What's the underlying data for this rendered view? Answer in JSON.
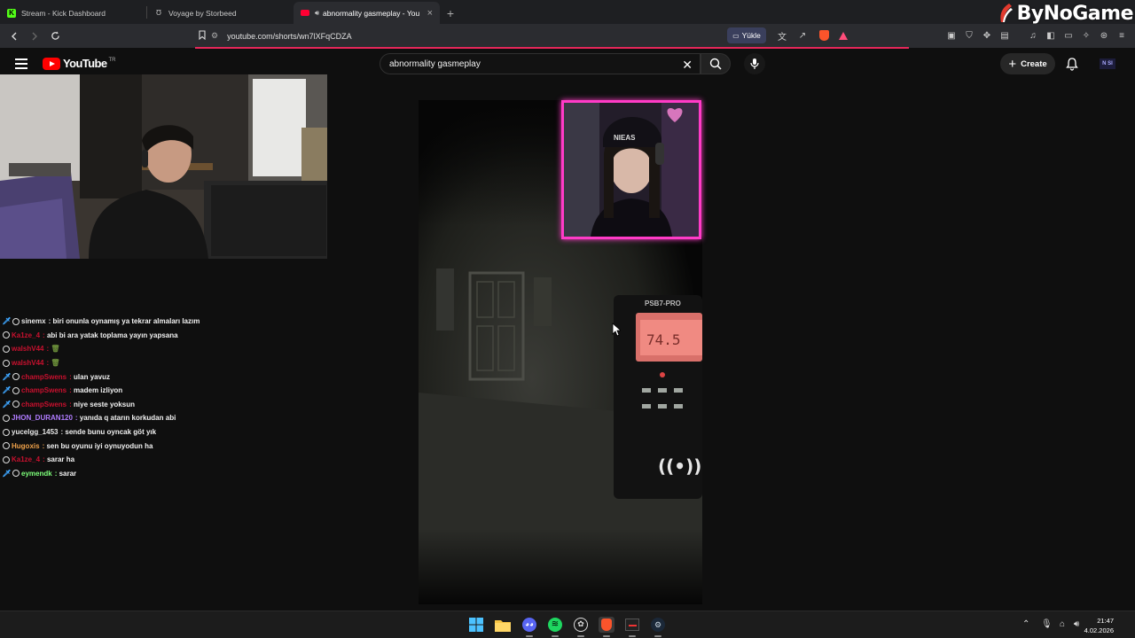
{
  "browser": {
    "tabs": [
      {
        "title": "Stream - Kick Dashboard",
        "favicon": "kick-icon",
        "color": "#53fc18",
        "active": false
      },
      {
        "title": "Voyage by Storbeed",
        "favicon": "storbeed-icon",
        "color": "#cccccc",
        "active": false
      },
      {
        "title": "abnormality gasmeplay - You",
        "favicon": "youtube-icon",
        "color": "#ff0033",
        "active": true
      }
    ],
    "new_tab": "+",
    "url": "youtube.com/shorts/wn7lXFqCDZA",
    "yukle_label": "Yükle",
    "overlay_logo": "ByNoGame"
  },
  "youtube": {
    "logo_text": "YouTube",
    "region": "TR",
    "search_value": "abnormality gasmeplay",
    "create_label": "Create",
    "avatar_text": "N SI"
  },
  "chat": [
    {
      "badges": [
        "sword",
        "ring"
      ],
      "name": "sinemx",
      "name_color": "#e8e8e8",
      "text": "biri onunla oynamış ya tekrar almaları lazım"
    },
    {
      "badges": [
        "ring"
      ],
      "name": "Ka1ze_4",
      "name_color": "#c8102e",
      "text": "abi bi ara yatak toplama yayın yapsana"
    },
    {
      "badges": [
        "ring"
      ],
      "name": "walshV44",
      "name_color": "#c8102e",
      "text": "🗑"
    },
    {
      "badges": [
        "ring"
      ],
      "name": "walshV44",
      "name_color": "#c8102e",
      "text": "🗑"
    },
    {
      "badges": [
        "sword",
        "ring"
      ],
      "name": "champSwens",
      "name_color": "#c8102e",
      "text": "ulan yavuz"
    },
    {
      "badges": [
        "sword",
        "ring"
      ],
      "name": "champSwens",
      "name_color": "#c8102e",
      "text": "madem izliyon"
    },
    {
      "badges": [
        "sword",
        "ring"
      ],
      "name": "champSwens",
      "name_color": "#c8102e",
      "text": "niye seste yoksun"
    },
    {
      "badges": [
        "ring"
      ],
      "name": "JHON_DURAN120",
      "name_color": "#b07cff",
      "text": "yanıda q atarın korkudan abi"
    },
    {
      "badges": [
        "ring"
      ],
      "name": "yucelgg_1453",
      "name_color": "#e8e8e8",
      "text": "sende bunu oyncak göt yık"
    },
    {
      "badges": [
        "ring"
      ],
      "name": "Hugoxis",
      "name_color": "#f0a24a",
      "text": "sen bu oyunu iyi oynuyodun ha"
    },
    {
      "badges": [
        "ring"
      ],
      "name": "Ka1ze_4",
      "name_color": "#c8102e",
      "text": "sarar ha"
    },
    {
      "badges": [
        "sword",
        "ring"
      ],
      "name": "eymendk",
      "name_color": "#7dff7a",
      "text": "sarar"
    }
  ],
  "taskbar": {
    "apps": [
      "windows-start-icon",
      "file-explorer-icon",
      "discord-icon",
      "spotify-icon",
      "chatgpt-icon",
      "brave-browser-icon",
      "obs-icon",
      "steam-icon"
    ],
    "time": "21:47",
    "date": "4.02.2026"
  }
}
